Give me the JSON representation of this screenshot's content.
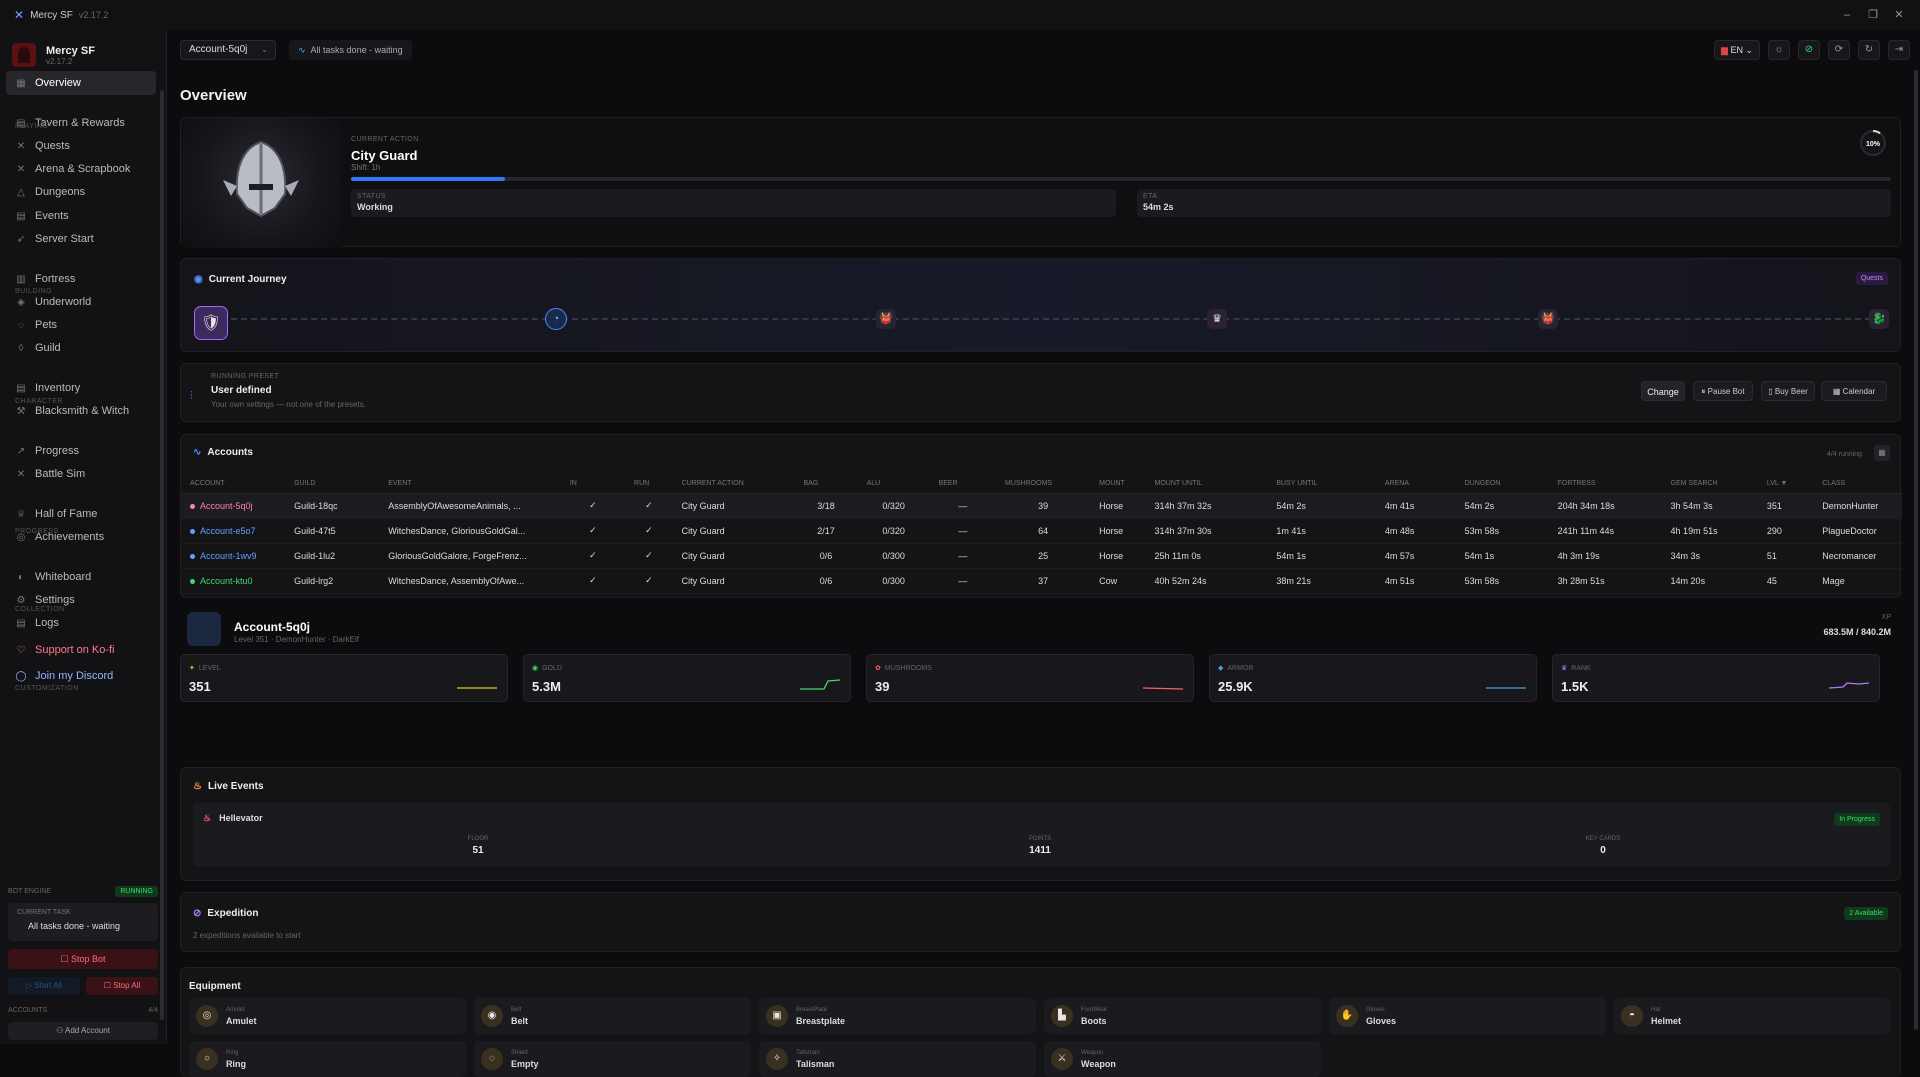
{
  "window": {
    "title": "Mercy SF",
    "version": "v2.17.2",
    "controls": [
      "–",
      "❐",
      "✕"
    ]
  },
  "sidebar": {
    "brand": {
      "name": "Mercy SF",
      "version": "v2.17.2"
    },
    "items": [
      {
        "label": "Overview",
        "icon": "grid-icon",
        "glyph": "▦"
      },
      {
        "label": "Tavern & Rewards",
        "icon": "tavern-icon",
        "glyph": "▤"
      },
      {
        "label": "Quests",
        "icon": "swords-icon",
        "glyph": "✕"
      },
      {
        "label": "Arena & Scrapbook",
        "icon": "arena-icon",
        "glyph": "✕"
      },
      {
        "label": "Dungeons",
        "icon": "dungeon-icon",
        "glyph": "△"
      },
      {
        "label": "Events",
        "icon": "calendar-icon",
        "glyph": "▤"
      },
      {
        "label": "Server Start",
        "icon": "rocket-icon",
        "glyph": "➶"
      },
      {
        "label": "Fortress",
        "icon": "castle-icon",
        "glyph": "▥"
      },
      {
        "label": "Underworld",
        "icon": "flame-icon",
        "glyph": "◈"
      },
      {
        "label": "Pets",
        "icon": "paw-icon",
        "glyph": "◌"
      },
      {
        "label": "Guild",
        "icon": "shield-icon",
        "glyph": "◊"
      },
      {
        "label": "Inventory",
        "icon": "backpack-icon",
        "glyph": "▤"
      },
      {
        "label": "Blacksmith & Witch",
        "icon": "hammer-icon",
        "glyph": "⚒"
      },
      {
        "label": "Progress",
        "icon": "trend-icon",
        "glyph": "↗"
      },
      {
        "label": "Battle Sim",
        "icon": "sword-icon",
        "glyph": "✕"
      },
      {
        "label": "Hall of Fame",
        "icon": "trophy-icon",
        "glyph": "♕"
      },
      {
        "label": "Achievements",
        "icon": "medal-icon",
        "glyph": "◎"
      },
      {
        "label": "Whiteboard",
        "icon": "palette-icon",
        "glyph": "◐"
      },
      {
        "label": "Settings",
        "icon": "gear-icon",
        "glyph": "⚙"
      },
      {
        "label": "Logs",
        "icon": "file-icon",
        "glyph": "▤"
      },
      {
        "label": "Support on Ko-fi",
        "icon": "heart-icon",
        "glyph": "♡"
      },
      {
        "label": "Join my Discord",
        "icon": "chat-icon",
        "glyph": "◯"
      }
    ],
    "sections": {
      "playing": "PLAYING",
      "building": "BUILDING",
      "character": "CHARACTER",
      "progress": "PROGRESS",
      "collection": "COLLECTION",
      "customization": "CUSTOMIZATION"
    },
    "bot_engine": {
      "label": "BOT ENGINE",
      "state": "RUNNING",
      "task_label": "CURRENT TASK",
      "task_value": "All tasks done - waiting",
      "stop_bot": "Stop Bot",
      "start_all": "Start All",
      "stop_all": "Stop All",
      "accounts_label": "ACCOUNTS",
      "accounts_count": "4/4",
      "add_account": "Add Account"
    }
  },
  "topbar": {
    "account": "Account-5q0j",
    "status": "All tasks done - waiting",
    "lang": "EN"
  },
  "page_title": "Overview",
  "current_action": {
    "label": "CURRENT ACTION",
    "title": "City Guard",
    "subtitle": "Shift: 1h",
    "progress": 0.1,
    "percent_text": "10%",
    "status_label": "STATUS",
    "status_value": "Working",
    "eta_label": "ETA",
    "eta_value": "54m 2s"
  },
  "journey": {
    "title": "Current Journey",
    "tag": "Quests",
    "nodes": [
      "🛡",
      "◔",
      "👹",
      "♛",
      "👹",
      "🐉"
    ]
  },
  "preset": {
    "label": "RUNNING PRESET",
    "title": "User defined",
    "subtitle": "Your own settings — not one of the presets.",
    "change": "Change",
    "pause": "Pause Bot",
    "beer": "Buy Beer",
    "calendar": "Calendar"
  },
  "accounts": {
    "title": "Accounts",
    "running": "4/4 running",
    "columns": [
      "ACCOUNT",
      "GUILD",
      "EVENT",
      "IN",
      "RUN",
      "CURRENT ACTION",
      "BAG",
      "ALU",
      "BEER",
      "MUSHROOMS",
      "MOUNT",
      "MOUNT UNTIL",
      "BUSY UNTIL",
      "ARENA",
      "DUNGEON",
      "FORTRESS",
      "GEM SEARCH",
      "LVL ▼",
      "CLASS"
    ],
    "rows": [
      [
        "Account-5q0j",
        "Guild-18qc",
        "AssemblyOfAwesomeAnimals, ...",
        "✓",
        "✓",
        "City Guard",
        "3/18",
        "0/320",
        "—",
        "39",
        "Horse",
        "314h 37m 32s",
        "54m 2s",
        "4m 41s",
        "54m 2s",
        "204h 34m 18s",
        "3h 54m 3s",
        "351",
        "DemonHunter"
      ],
      [
        "Account-e5o7",
        "Guild-47t5",
        "WitchesDance, GloriousGoldGal...",
        "✓",
        "✓",
        "City Guard",
        "2/17",
        "0/320",
        "—",
        "64",
        "Horse",
        "314h 37m 30s",
        "1m 41s",
        "4m 48s",
        "53m 58s",
        "241h 11m 44s",
        "4h 19m 51s",
        "290",
        "PlagueDoctor"
      ],
      [
        "Account-1wv9",
        "Guild-1lu2",
        "GloriousGoldGalore, ForgeFrenz...",
        "✓",
        "✓",
        "City Guard",
        "0/6",
        "0/300",
        "—",
        "25",
        "Horse",
        "25h 11m 0s",
        "54m 1s",
        "4m 57s",
        "54m 1s",
        "4h 3m 19s",
        "34m 3s",
        "51",
        "Necromancer"
      ],
      [
        "Account-ktu0",
        "Guild-lrg2",
        "WitchesDance, AssemblyOfAwe...",
        "✓",
        "✓",
        "City Guard",
        "0/6",
        "0/300",
        "—",
        "37",
        "Cow",
        "40h 52m 24s",
        "38m 21s",
        "4m 51s",
        "53m 58s",
        "3h 28m 51s",
        "14m 20s",
        "45",
        "Mage"
      ]
    ],
    "row_colors": [
      "#ff7fbd",
      "#6a9fff",
      "#6a9fff",
      "#3ddc6c"
    ]
  },
  "account_detail": {
    "name": "Account-5q0j",
    "subtitle": "Level 351 · DemonHunter · DarkElf",
    "xp_label": "XP",
    "xp_value": "683.5M / 840.2M",
    "stats": [
      {
        "label": "LEVEL",
        "value": "351",
        "glyph": "✦",
        "color": "#e0c030"
      },
      {
        "label": "GOLD",
        "value": "5.3M",
        "glyph": "◉",
        "color": "#3ddc6c"
      },
      {
        "label": "MUSHROOMS",
        "value": "39",
        "glyph": "✿",
        "color": "#ff5a6a"
      },
      {
        "label": "ARMOR",
        "value": "25.9K",
        "glyph": "◆",
        "color": "#3aa8d8"
      },
      {
        "label": "RANK",
        "value": "1.5K",
        "glyph": "♛",
        "color": "#b07aff"
      }
    ]
  },
  "live_events": {
    "title": "Live Events",
    "event_name": "Hellevator",
    "status": "In Progress",
    "floor_label": "FLOOR",
    "floor": "51",
    "points_label": "POINTS",
    "points": "1411",
    "keycards_label": "KEY CARDS",
    "keycards": "0"
  },
  "expedition": {
    "title": "Expedition",
    "subtitle": "2 expeditions available to start",
    "tag": "2 Available"
  },
  "equipment": {
    "title": "Equipment",
    "items": [
      {
        "slot": "Amulet",
        "name": "Amulet",
        "glyph": "◎"
      },
      {
        "slot": "Belt",
        "name": "Belt",
        "glyph": "◉"
      },
      {
        "slot": "BreastPlate",
        "name": "Breastplate",
        "glyph": "▣"
      },
      {
        "slot": "FootWear",
        "name": "Boots",
        "glyph": "▙"
      },
      {
        "slot": "Gloves",
        "name": "Gloves",
        "glyph": "✋"
      },
      {
        "slot": "Hat",
        "name": "Helmet",
        "glyph": "◓"
      },
      {
        "slot": "Ring",
        "name": "Ring",
        "glyph": "○"
      },
      {
        "slot": "Shield",
        "name": "Empty",
        "glyph": "◌"
      },
      {
        "slot": "Talisman",
        "name": "Talisman",
        "glyph": "✧"
      },
      {
        "slot": "Weapon",
        "name": "Weapon",
        "glyph": "⚔"
      }
    ]
  }
}
